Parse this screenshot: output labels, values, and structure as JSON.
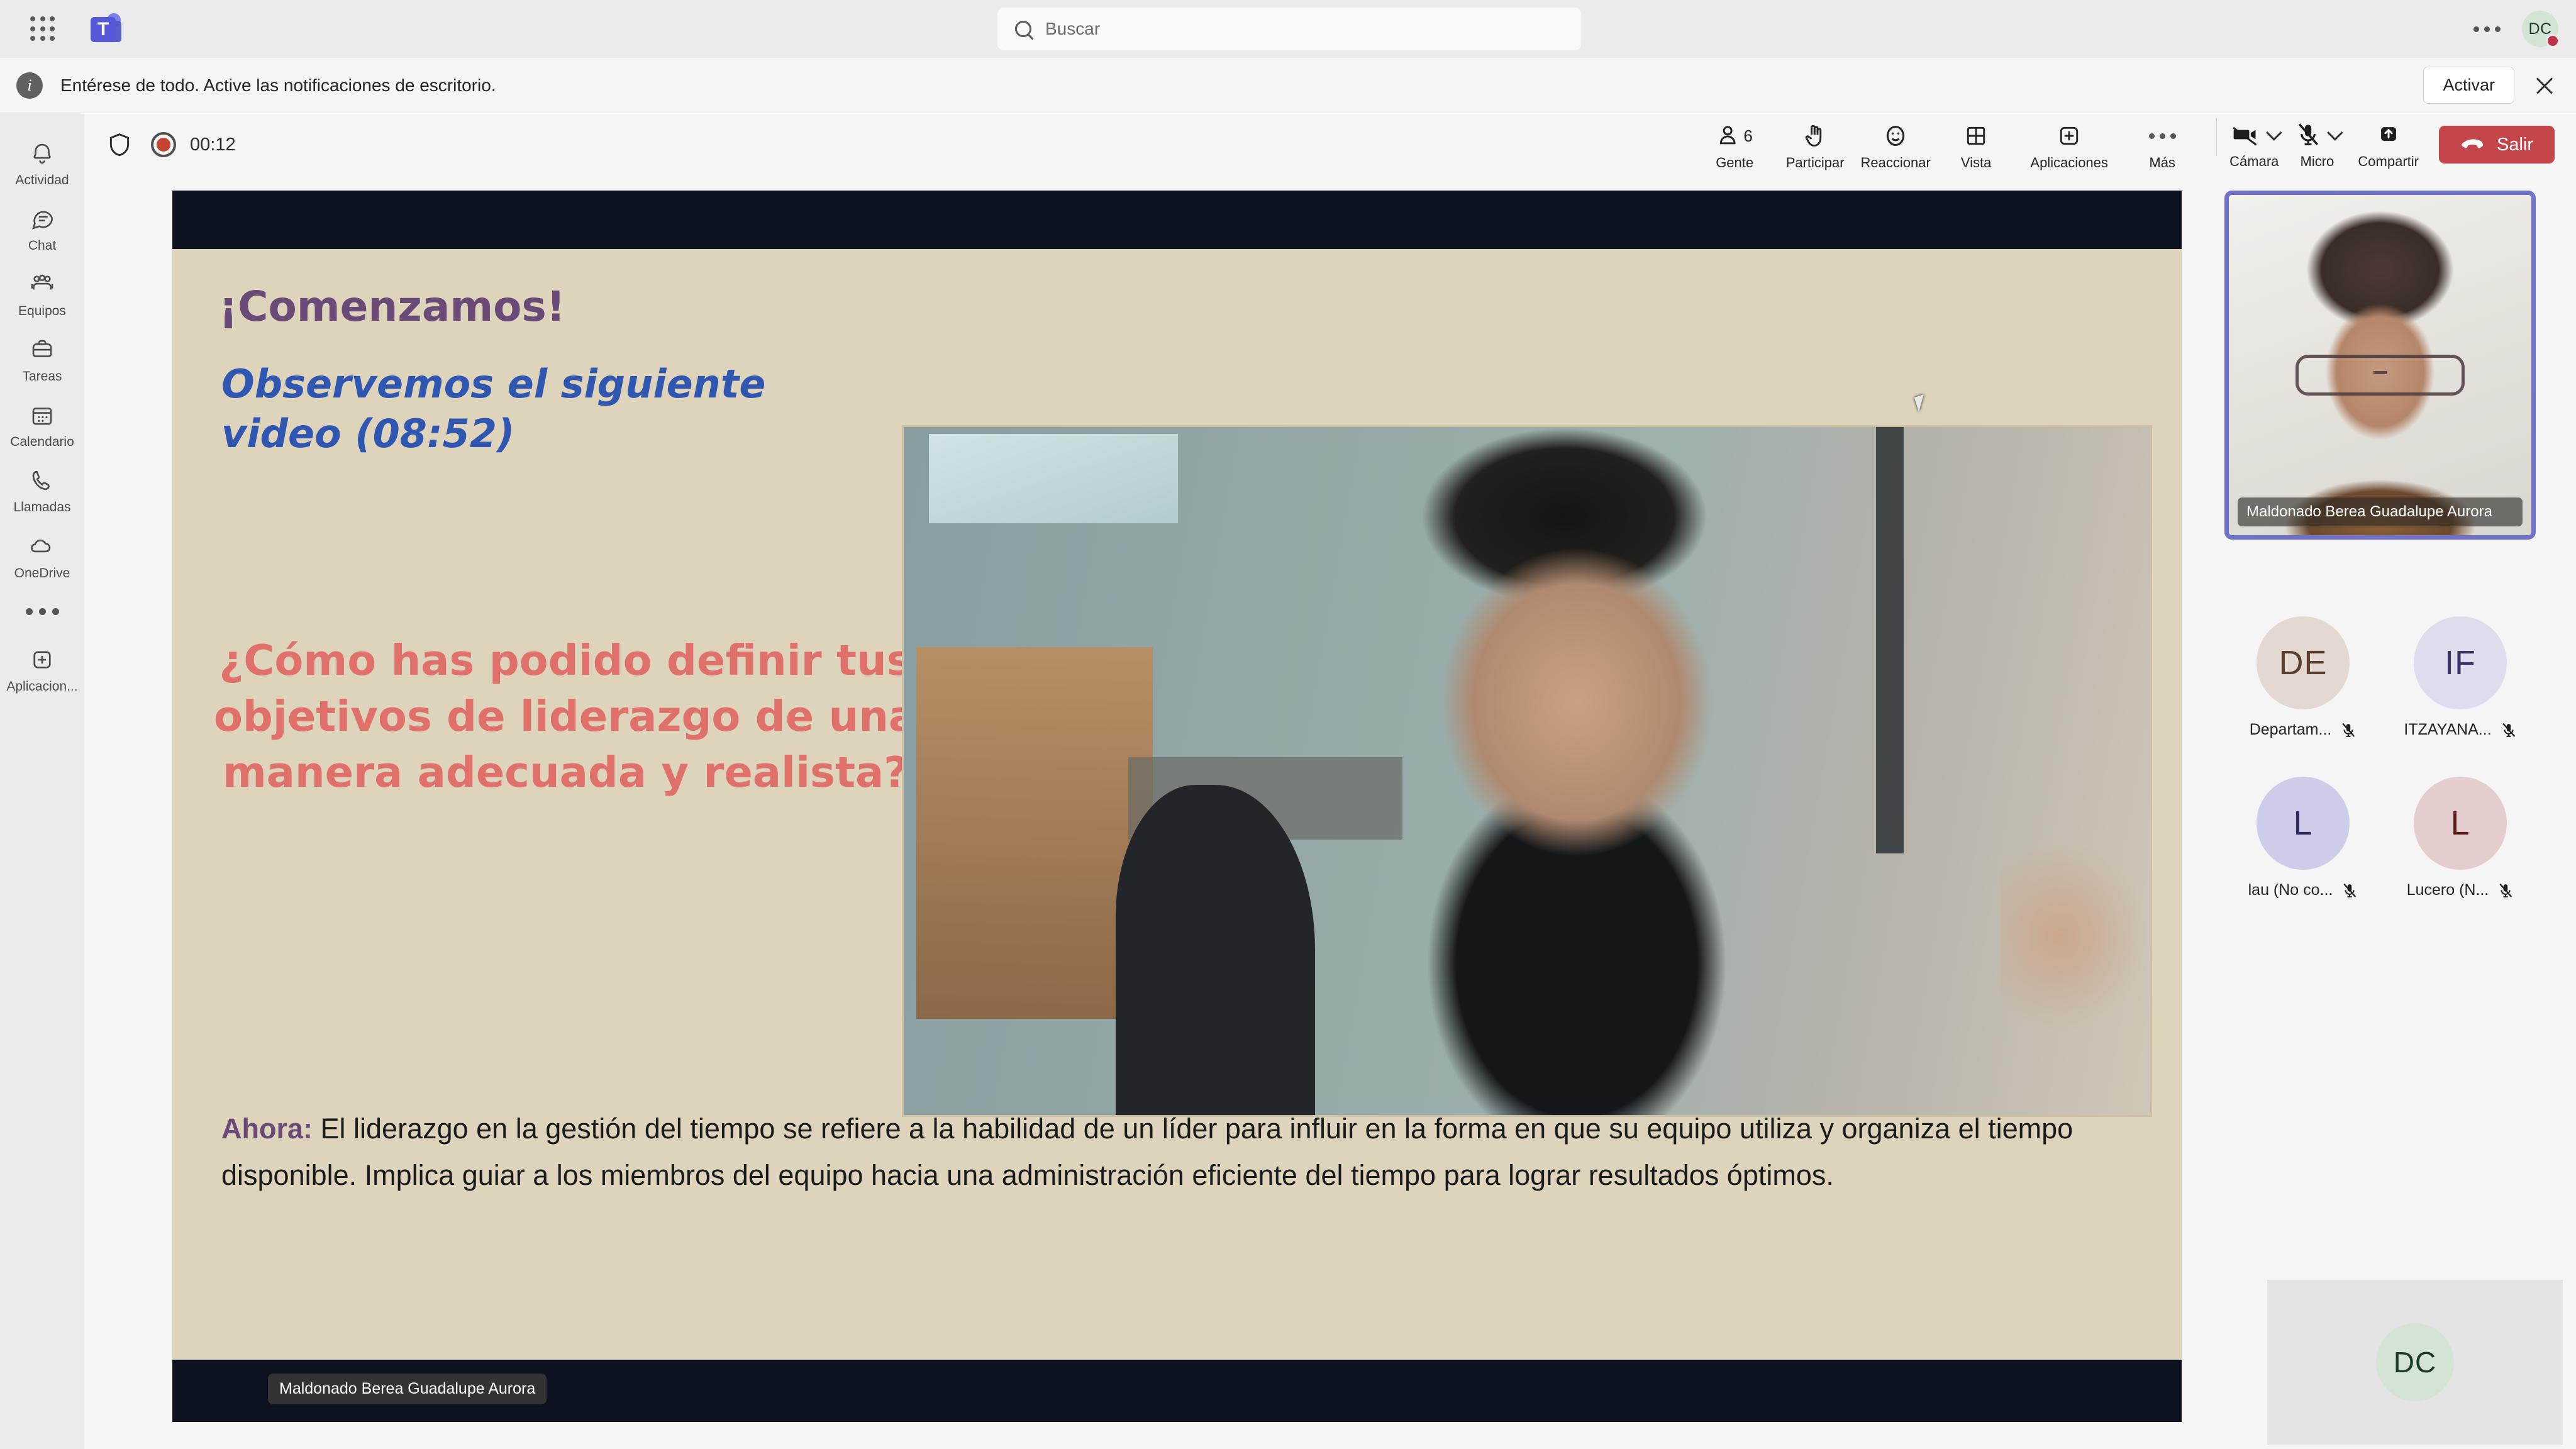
{
  "app": {
    "name": "Microsoft Teams",
    "waffle_icon": "app-launcher-icon",
    "logo_letter": "T"
  },
  "search": {
    "placeholder": "Buscar",
    "icon": "search-icon"
  },
  "topbar": {
    "overflow_icon": "ellipsis-icon",
    "avatar_initials": "DC",
    "presence_status_color": "#c4314b"
  },
  "banner": {
    "icon": "info-icon",
    "message": "Entérese de todo. Active las notificaciones de escritorio.",
    "action_label": "Activar",
    "close_icon": "close-icon"
  },
  "sidebar": {
    "items": [
      {
        "label": "Actividad",
        "icon": "bell-icon"
      },
      {
        "label": "Chat",
        "icon": "chat-bubble-icon"
      },
      {
        "label": "Equipos",
        "icon": "people-icon"
      },
      {
        "label": "Tareas",
        "icon": "tasks-icon"
      },
      {
        "label": "Calendario",
        "icon": "calendar-icon"
      },
      {
        "label": "Llamadas",
        "icon": "phone-icon"
      },
      {
        "label": "OneDrive",
        "icon": "cloud-icon"
      }
    ],
    "more_icon": "ellipsis-icon",
    "apps": {
      "label": "Aplicacion...",
      "icon": "plus-box-icon"
    }
  },
  "meeting": {
    "shield_icon": "shield-icon",
    "recording_icon": "record-icon",
    "timer": "00:12",
    "tools": [
      {
        "label": "Gente",
        "icon": "person-icon",
        "count": "6"
      },
      {
        "label": "Participar",
        "icon": "raise-hand-icon"
      },
      {
        "label": "Reaccionar",
        "icon": "smiley-icon"
      },
      {
        "label": "Vista",
        "icon": "grid-view-icon"
      },
      {
        "label": "Aplicaciones",
        "icon": "plus-box-icon"
      },
      {
        "label": "Más",
        "icon": "ellipsis-icon"
      }
    ],
    "camera": {
      "label": "Cámara",
      "icon": "camera-off-icon",
      "chevron": "chevron-down-icon"
    },
    "mic": {
      "label": "Micro",
      "icon": "mic-off-icon",
      "chevron": "chevron-down-icon"
    },
    "share": {
      "label": "Compartir",
      "icon": "share-screen-icon"
    },
    "leave": {
      "label": "Salir",
      "icon": "hangup-icon",
      "color": "#c4454a"
    }
  },
  "shared_content": {
    "presenter_label": "Maldonado Berea Guadalupe Aurora",
    "slide": {
      "title": "¡Comenzamos!",
      "title_color": "#6a4a76",
      "subtitle": "Observemos el siguiente video (08:52)",
      "subtitle_color": "#2f56b0",
      "question": "¿Cómo has podido definir tus objetivos de liderazgo de una manera adecuada y realista?",
      "question_color": "#e0716a",
      "body_lead": "Ahora:",
      "body_text": " El liderazgo en la gestión del tiempo se refiere a la habilidad de un líder para influir en la forma en que su equipo utiliza y organiza el tiempo disponible. Implica guiar a los miembros del equipo hacia una administración eficiente del tiempo para lograr resultados óptimos.",
      "background_color": "#ded3bb"
    }
  },
  "roster": {
    "self_view": {
      "name": "Maldonado Berea Guadalupe Aurora",
      "border_color": "#6f70c8"
    },
    "participants": [
      {
        "initials": "DE",
        "name": "Departam...",
        "bg": "#e3d8d2",
        "fg": "#5a3f2e",
        "mic_icon": "mic-off-icon"
      },
      {
        "initials": "IF",
        "name": "ITZAYANA...",
        "bg": "#e0dcee",
        "fg": "#3b3566",
        "mic_icon": "mic-off-icon"
      },
      {
        "initials": "L",
        "name": "lau (No co...",
        "bg": "#cdcdea",
        "fg": "#2c2c63",
        "mic_icon": "mic-off-icon"
      },
      {
        "initials": "L",
        "name": "Lucero (N...",
        "bg": "#e4cdcd",
        "fg": "#5d1f20",
        "mic_icon": "mic-off-icon"
      }
    ],
    "spotlight_tile": {
      "initials": "DC",
      "bg": "#d3e4d5",
      "fg": "#1c3b27"
    }
  }
}
